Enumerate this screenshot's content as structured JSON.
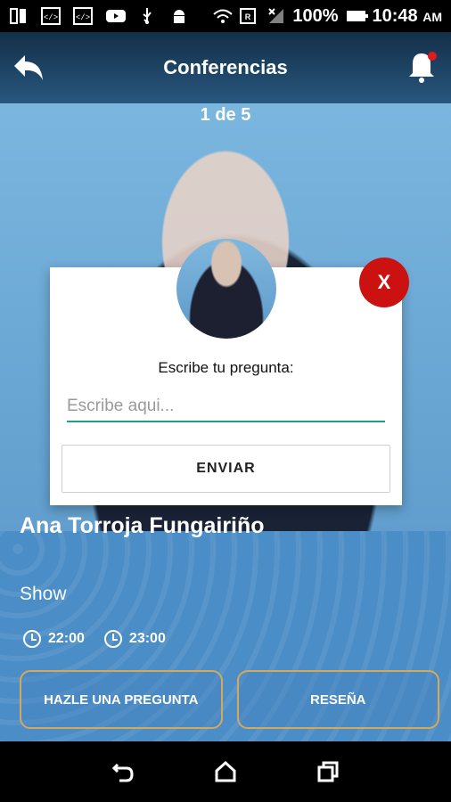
{
  "status_bar": {
    "battery": "100%",
    "time": "10:48",
    "ampm": "AM"
  },
  "app_bar": {
    "title": "Conferencias"
  },
  "carousel": {
    "counter": "1 de 5"
  },
  "dialog": {
    "close_label": "X",
    "prompt": "Escribe tu pregunta:",
    "input_placeholder": "Escribe aqui...",
    "input_value": "",
    "send_label": "ENVIAR"
  },
  "event": {
    "name": "Ana Torroja Fungairiño",
    "type": "Show",
    "start_time": "22:00",
    "end_time": "23:00"
  },
  "actions": {
    "ask_label": "HAZLE UNA PREGUNTA",
    "review_label": "RESEÑA"
  },
  "colors": {
    "accent_red": "#cc1111",
    "input_underline": "#1e9e8e",
    "button_border": "#d6a85c"
  }
}
